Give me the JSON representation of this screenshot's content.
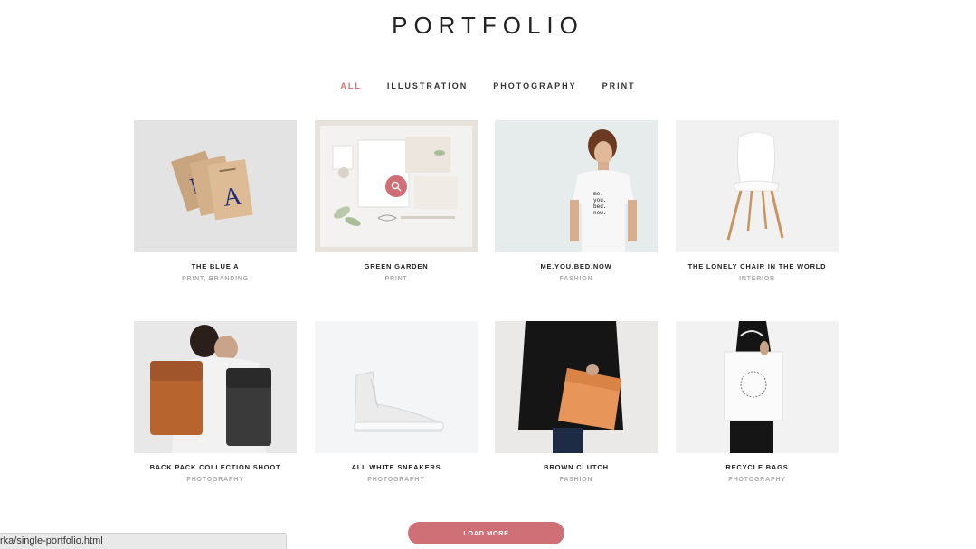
{
  "page": {
    "title": "PORTFOLIO"
  },
  "filters": [
    {
      "label": "ALL",
      "active": true
    },
    {
      "label": "ILLUSTRATION",
      "active": false
    },
    {
      "label": "PHOTOGRAPHY",
      "active": false
    },
    {
      "label": "PRINT",
      "active": false
    }
  ],
  "items": [
    {
      "title": "THE BLUE A",
      "category": "PRINT, BRANDING",
      "image": "notebooks-photo"
    },
    {
      "title": "GREEN GARDEN",
      "category": "PRINT",
      "image": "stationery-mockup-photo",
      "hover_icon": "search-icon"
    },
    {
      "title": "ME.YOU.BED.NOW",
      "category": "FASHION",
      "image": "tshirt-model-photo",
      "shirt_text": [
        "me.",
        "you.",
        "bed.",
        "now."
      ]
    },
    {
      "title": "THE LONELY CHAIR IN THE WORLD",
      "category": "INTERIOR",
      "image": "white-chair-photo"
    },
    {
      "title": "BACK PACK COLLECTION SHOOT",
      "category": "PHOTOGRAPHY",
      "image": "backpacks-photo"
    },
    {
      "title": "ALL WHITE SNEAKERS",
      "category": "PHOTOGRAPHY",
      "image": "sneaker-photo"
    },
    {
      "title": "BROWN CLUTCH",
      "category": "FASHION",
      "image": "clutch-photo"
    },
    {
      "title": "RECYCLE BAGS",
      "category": "PHOTOGRAPHY",
      "image": "tote-bag-photo"
    }
  ],
  "load_more": {
    "label": "LOAD MORE"
  },
  "status_bar": {
    "url": "rka/single-portfolio.html"
  },
  "colors": {
    "accent": "#cf7077",
    "text": "#222222",
    "muted": "#aaaaaa"
  }
}
